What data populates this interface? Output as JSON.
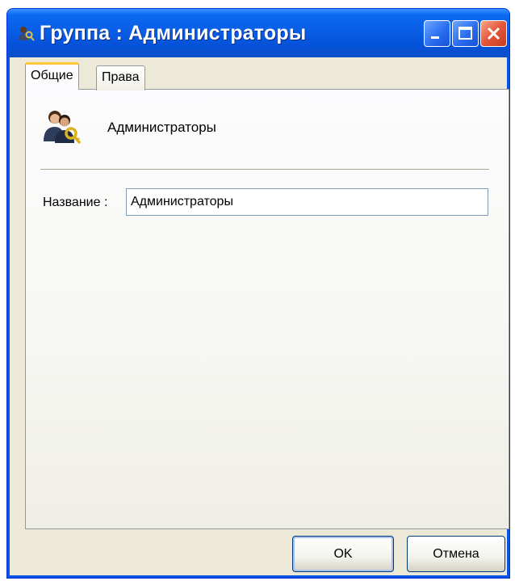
{
  "window": {
    "title": "Группа : Администраторы",
    "icon": "users-key-icon",
    "controls": {
      "minimize": "minimize-icon",
      "maximize": "maximize-icon",
      "close": "close-icon"
    }
  },
  "tabs": [
    {
      "label": "Общие",
      "active": true
    },
    {
      "label": "Права",
      "active": false
    }
  ],
  "general": {
    "group_icon": "users-key-icon",
    "group_name": "Администраторы",
    "name_label": "Название :",
    "name_value": "Администраторы"
  },
  "buttons": {
    "ok": "OK",
    "cancel": "Отмена"
  },
  "colors": {
    "titlebar": "#0a5ee6",
    "face": "#ece9d8",
    "active_tab_highlight": "#ffc83c",
    "close_button": "#e4563a"
  }
}
